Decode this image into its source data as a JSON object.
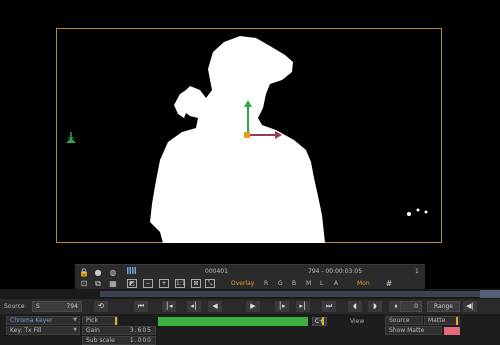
{
  "viewer": {
    "frame_number": "000401",
    "timecode_frame": "794",
    "timecode": "794 - 00:00:03:05",
    "timecode_right": "1",
    "overlay_label": "Overlay",
    "channels": [
      "R",
      "G",
      "B",
      "M",
      "L",
      "A"
    ],
    "mon_label": "Mon",
    "zoom_label": "1:1",
    "colors": {
      "frame_border": "#b78a3a",
      "gizmo_y": "#2fa64b",
      "gizmo_x": "#9a3a55",
      "gizmo_center": "#e0a020"
    }
  },
  "transport": {
    "source_label": "Source",
    "s_label": "S",
    "frame_value": "794",
    "range_value": "0",
    "range_label": "Range"
  },
  "panel": {
    "node_name": "Chroma Keyer",
    "key_type": "Key: Tx Fill",
    "pick_label": "Pick",
    "gain_label": "Gain",
    "gain_value": "3.605",
    "subscale_label": "Sub scale",
    "subscale_value": "1.000",
    "cplus_label": "C+",
    "view_label": "View",
    "source_label": "Source",
    "matte_label": "Matte",
    "show_matte_label": "Show Matte",
    "colors": {
      "gain_bar": "#3cb043",
      "swatch": "#e06a7a",
      "accent": "#e09a2a"
    }
  }
}
